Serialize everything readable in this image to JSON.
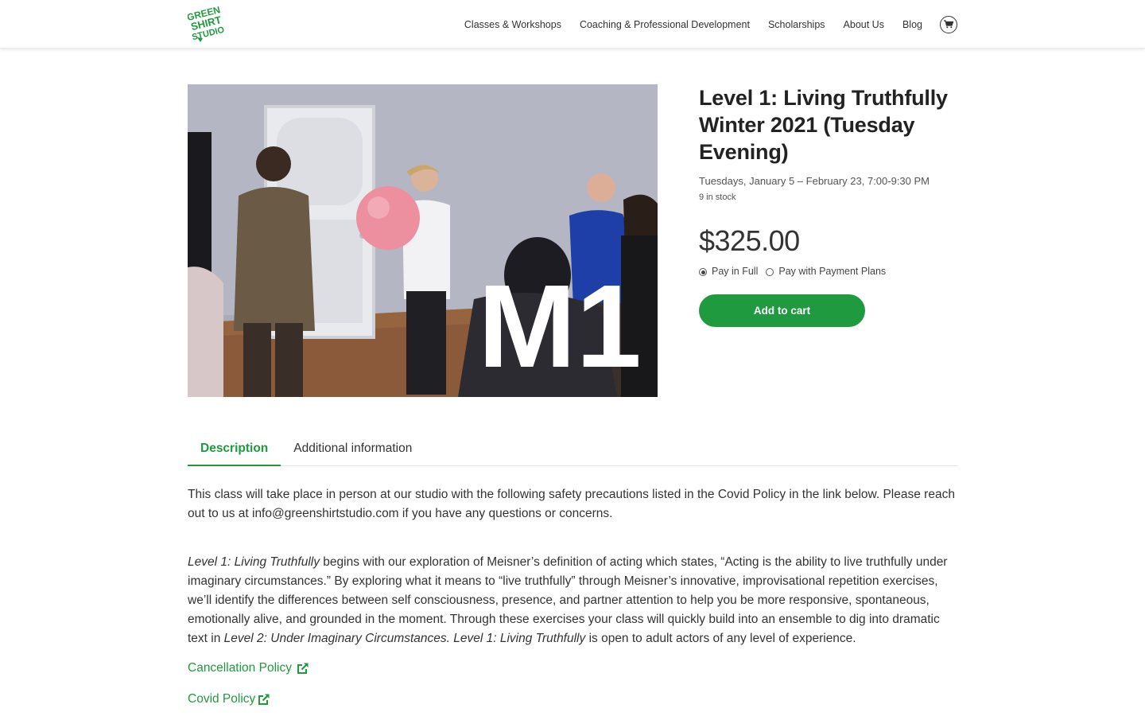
{
  "brand": {
    "logo_text": [
      "GREEN",
      "SHIRT",
      "STUDIO"
    ],
    "accent_color": "#1f9a3e"
  },
  "nav": {
    "items": [
      "Classes & Workshops",
      "Coaching & Professional Development",
      "Scholarships",
      "About Us",
      "Blog"
    ],
    "cart_icon": "cart-icon"
  },
  "product": {
    "image_overlay_text": "M1",
    "title": "Level 1: Living Truthfully Winter 2021 (Tuesday Evening)",
    "schedule": "Tuesdays, January 5 – February 23, 7:00-9:30 PM",
    "stock": "9 in stock",
    "price": "$325.00",
    "payment_options": [
      {
        "label": "Pay in Full",
        "selected": true
      },
      {
        "label": "Pay with Payment Plans",
        "selected": false
      }
    ],
    "add_to_cart_label": "Add to cart"
  },
  "tabs": [
    {
      "label": "Description",
      "active": true
    },
    {
      "label": "Additional information",
      "active": false
    }
  ],
  "description": {
    "paragraph1": "This class will take place in person at our studio with the following safety precautions listed in the Covid Policy in the link below. Please reach out to us at info@greenshirtstudio.com if you have any questions or concerns.",
    "p2_italic1": "Level 1: Living Truthfully",
    "p2_text1": " begins with our exploration of Meisner’s definition of acting which states, “Acting is the ability to live truthfully under imaginary circumstances.” By exploring what it means to “live truthfully” through Meisner’s innovative, improvisational repetition exercises, we’ll identify the differences between self consciousness, presence, and partner attention to help you be more responsive, spontaneous, emotionally alive, and grounded in the moment. Through these exercises your class will quickly build into an ensemble to dig into dramatic text in ",
    "p2_italic2": "Level 2: Under Imaginary Circumstances. Level 1: Living Truthfully",
    "p2_text2": " is open to adult actors of any level of experience.",
    "links": [
      "Cancellation Policy",
      "Covid Policy"
    ]
  }
}
